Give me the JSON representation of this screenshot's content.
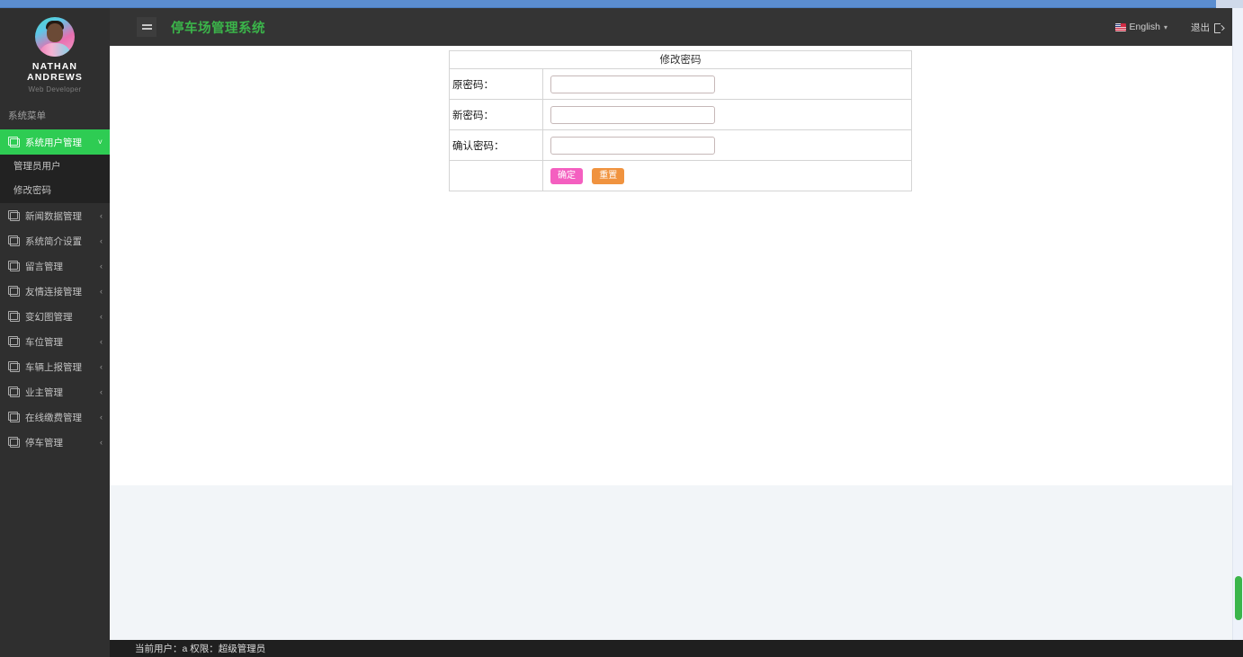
{
  "header": {
    "app_title": "停车场管理系统",
    "hamburger_icon": "hamburger-menu-icon",
    "language": {
      "label": "English",
      "flag_icon": "flag-icon",
      "caret_icon": "chevron-down-icon"
    },
    "logout": {
      "label": "退出",
      "icon": "sign-out-icon"
    }
  },
  "sidebar": {
    "profile": {
      "name_line1": "NATHAN",
      "name_line2": "ANDREWS",
      "role": "Web Developer",
      "avatar_icon": "user-avatar"
    },
    "menu_header": "系统菜单",
    "items": [
      {
        "label": "系统用户管理",
        "icon": "folder-copy-icon",
        "caret": "˅",
        "active": true
      },
      {
        "label": "新闻数据管理",
        "icon": "folder-copy-icon",
        "caret": "‹",
        "active": false
      },
      {
        "label": "系统简介设置",
        "icon": "folder-copy-icon",
        "caret": "‹",
        "active": false
      },
      {
        "label": "留言管理",
        "icon": "folder-copy-icon",
        "caret": "‹",
        "active": false
      },
      {
        "label": "友情连接管理",
        "icon": "folder-copy-icon",
        "caret": "‹",
        "active": false
      },
      {
        "label": "变幻图管理",
        "icon": "folder-copy-icon",
        "caret": "‹",
        "active": false
      },
      {
        "label": "车位管理",
        "icon": "folder-copy-icon",
        "caret": "‹",
        "active": false
      },
      {
        "label": "车辆上报管理",
        "icon": "folder-copy-icon",
        "caret": "‹",
        "active": false
      },
      {
        "label": "业主管理",
        "icon": "folder-copy-icon",
        "caret": "‹",
        "active": false
      },
      {
        "label": "在线缴费管理",
        "icon": "folder-copy-icon",
        "caret": "‹",
        "active": false
      },
      {
        "label": "停车管理",
        "icon": "folder-copy-icon",
        "caret": "‹",
        "active": false
      }
    ],
    "submenu": [
      {
        "label": "管理员用户"
      },
      {
        "label": "修改密码"
      }
    ]
  },
  "form": {
    "title": "修改密码",
    "fields": [
      {
        "label": "原密码：",
        "value": "",
        "placeholder": ""
      },
      {
        "label": "新密码：",
        "value": "",
        "placeholder": ""
      },
      {
        "label": "确认密码：",
        "value": "",
        "placeholder": ""
      }
    ],
    "buttons": {
      "confirm": "确定",
      "reset": "重置"
    }
  },
  "footer": {
    "status": "当前用户：a 权限：超级管理员"
  },
  "colors": {
    "accent_green": "#2ecc53",
    "title_green": "#3bb54a",
    "sidebar_bg": "#2f2f2f",
    "submenu_bg": "#222222",
    "header_bg": "#343434",
    "footer_bg": "#1f1f1f",
    "confirm_pink": "#f45fc0",
    "reset_orange": "#f0933f",
    "lower_panel": "#f2f5f8",
    "top_strip_blue": "#5b8dd0"
  }
}
